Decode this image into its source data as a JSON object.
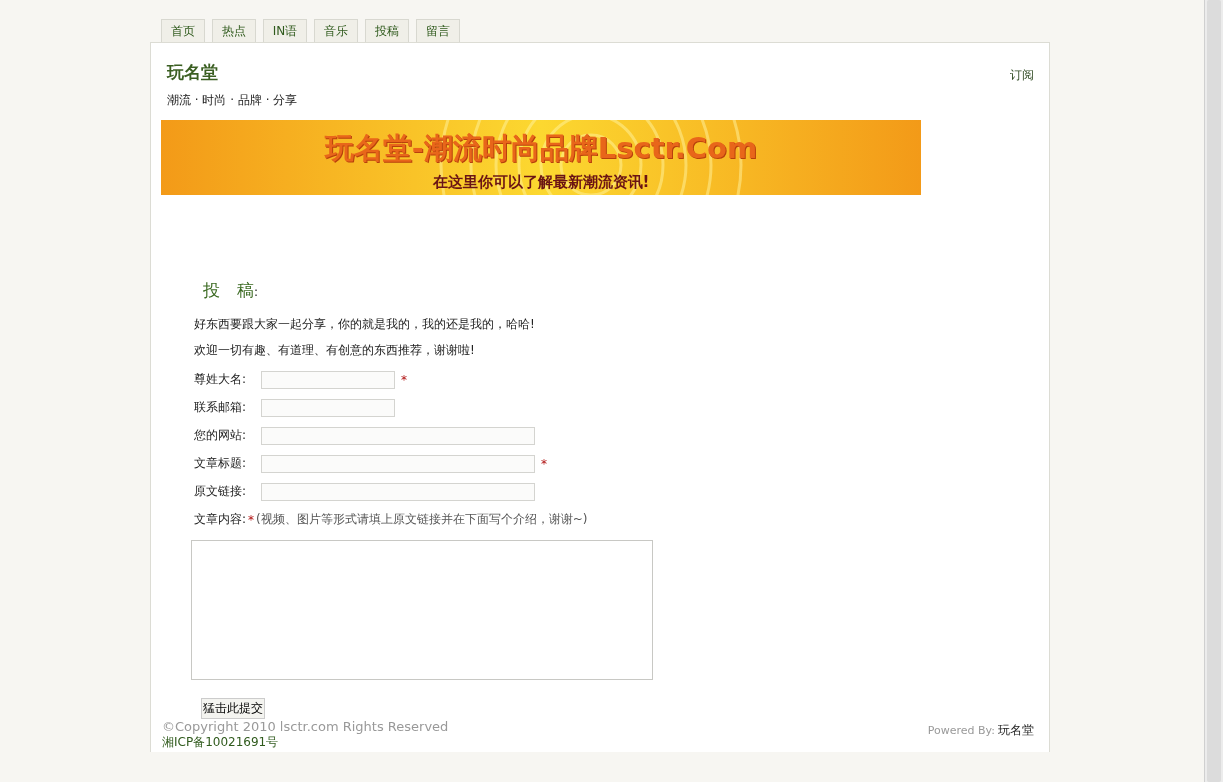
{
  "nav_tabs": [
    {
      "label": "首页",
      "selected": false
    },
    {
      "label": "热点",
      "selected": false
    },
    {
      "label": "IN语",
      "selected": false
    },
    {
      "label": "音乐",
      "selected": false
    },
    {
      "label": "投稿",
      "selected": false
    },
    {
      "label": "留言",
      "selected": false
    }
  ],
  "site": {
    "title": "玩名堂",
    "tagline": "潮流 · 时尚 · 品牌 · 分享",
    "subscribe": "订阅"
  },
  "banner": {
    "headline": "玩名堂-潮流时尚品牌Lsctr.Com",
    "subline": "在这里你可以了解最新潮流资讯!"
  },
  "form": {
    "heading": "投　稿",
    "heading_colon": ":",
    "intro": [
      "好东西要跟大家一起分享，你的就是我的，我的还是我的，哈哈!",
      "欢迎一切有趣、有道理、有创意的东西推荐，谢谢啦!"
    ],
    "fields": [
      {
        "label": "尊姓大名:",
        "kind": "short",
        "required": true
      },
      {
        "label": "联系邮箱:",
        "kind": "short",
        "required": false
      },
      {
        "label": "您的网站:",
        "kind": "long",
        "required": false
      },
      {
        "label": "文章标题:",
        "kind": "long",
        "required": true
      },
      {
        "label": "原文链接:",
        "kind": "long",
        "required": false
      }
    ],
    "content": {
      "label": "文章内容:",
      "required": true,
      "hint": "(视频、图片等形式请填上原文链接并在下面写个介绍，谢谢~)"
    },
    "submit": "猛击此提交",
    "required_mark": "*"
  },
  "footer": {
    "copyright": "©Copyright 2010 lsctr.com Rights Reserved",
    "icp": "湘ICP备10021691号",
    "powered_by": "Powered By:",
    "powered_name": "玩名堂"
  }
}
